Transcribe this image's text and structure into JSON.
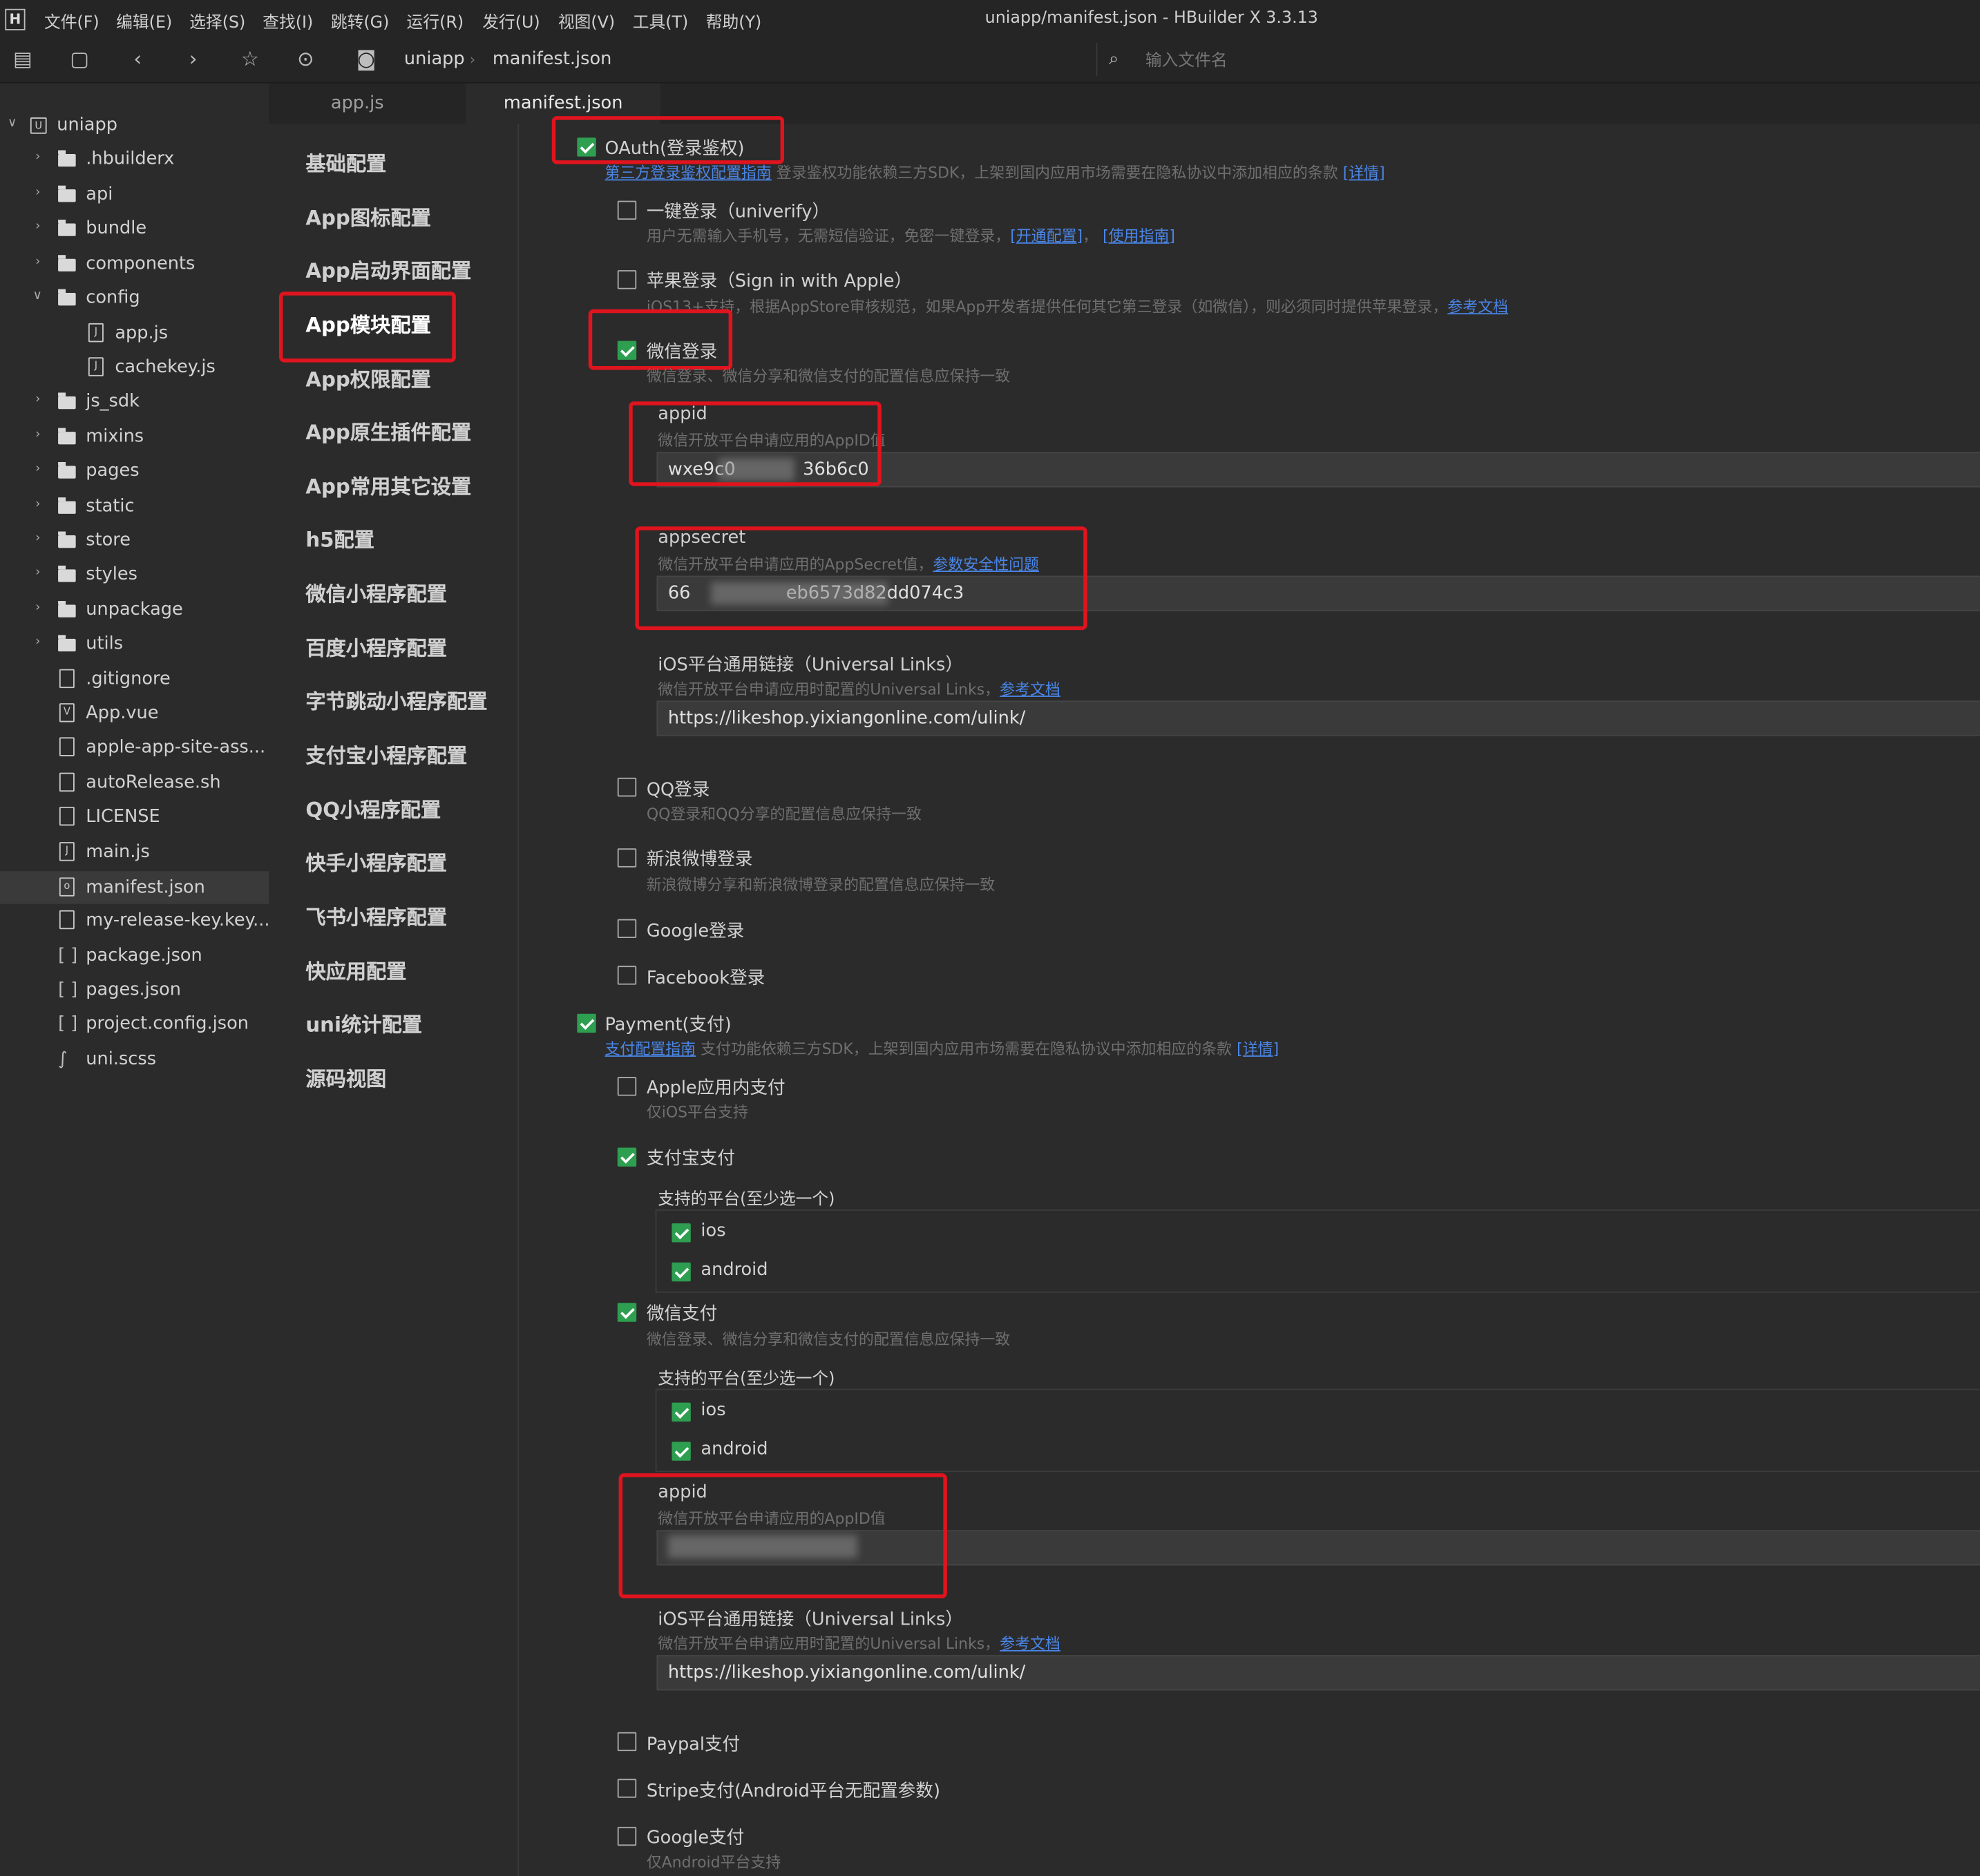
{
  "menubar": {
    "logo": "H",
    "items": [
      "文件(F)",
      "编辑(E)",
      "选择(S)",
      "查找(I)",
      "跳转(G)",
      "运行(R)",
      "发行(U)",
      "视图(V)",
      "工具(T)",
      "帮助(Y)"
    ],
    "title": "uniapp/manifest.json - HBuilder X 3.3.13"
  },
  "toolbar": {
    "crumbs": [
      "uniapp",
      "manifest.json"
    ],
    "search_placeholder": "输入文件名"
  },
  "sidebar": {
    "root": "uniapp",
    "items": [
      ".hbuilderx",
      "api",
      "bundle",
      "components",
      "config",
      "app.js",
      "cachekey.js",
      "js_sdk",
      "mixins",
      "pages",
      "static",
      "store",
      "styles",
      "unpackage",
      "utils",
      ".gitignore",
      "App.vue",
      "apple-app-site-ass...",
      "autoRelease.sh",
      "LICENSE",
      "main.js",
      "manifest.json",
      "my-release-key.key...",
      "package.json",
      "pages.json",
      "project.config.json",
      "uni.scss"
    ]
  },
  "tabs": [
    "app.js",
    "manifest.json"
  ],
  "nav": [
    "基础配置",
    "App图标配置",
    "App启动界面配置",
    "App模块配置",
    "App权限配置",
    "App原生插件配置",
    "App常用其它设置",
    "h5配置",
    "微信小程序配置",
    "百度小程序配置",
    "字节跳动小程序配置",
    "支付宝小程序配置",
    "QQ小程序配置",
    "快手小程序配置",
    "飞书小程序配置",
    "快应用配置",
    "uni统计配置",
    "源码视图"
  ],
  "oauth": {
    "label": "OAuth(登录鉴权)",
    "guide_link": "第三方登录鉴权配置指南",
    "guide_text": "登录鉴权功能依赖三方SDK，上架到国内应用市场需要在隐私协议中添加相应的条款",
    "detail_link": "[详情]",
    "univerify_label": "一键登录（univerify）",
    "univerify_desc": "用户无需输入手机号，无需短信验证，免密一键登录，",
    "univerify_link1": "[开通配置]",
    "univerify_sep": "，",
    "univerify_link2": "[使用指南]",
    "apple_label": "苹果登录（Sign in with Apple）",
    "apple_desc": "iOS13+支持，根据AppStore审核规范，如果App开发者提供任何其它第三登录（如微信），则必须同时提供苹果登录，",
    "apple_link": "参考文档",
    "wechat_label": "微信登录",
    "wechat_desc": "微信登录、微信分享和微信支付的配置信息应保持一致",
    "appid_label": "appid",
    "appid_desc": "微信开放平台申请应用的AppID值",
    "appid_value": "wxe9c0            36b6c0",
    "appsecret_label": "appsecret",
    "appsecret_desc": "微信开放平台申请应用的AppSecret值，",
    "appsecret_link": "参数安全性问题",
    "appsecret_value": "66                 eb6573d82dd074c3",
    "ulink_label": "iOS平台通用链接（Universal Links）",
    "ulink_desc": "微信开放平台申请应用时配置的Universal Links，",
    "ulink_link": "参考文档",
    "ulink_value": "https://likeshop.yixiangonline.com/ulink/",
    "qq_label": "QQ登录",
    "qq_desc": "QQ登录和QQ分享的配置信息应保持一致",
    "weibo_label": "新浪微博登录",
    "weibo_desc": "新浪微博分享和新浪微博登录的配置信息应保持一致",
    "google_label": "Google登录",
    "facebook_label": "Facebook登录"
  },
  "payment": {
    "label": "Payment(支付)",
    "guide_link": "支付配置指南",
    "guide_text": "支付功能依赖三方SDK，上架到国内应用市场需要在隐私协议中添加相应的条款",
    "detail_link": "[详情]",
    "apple_label": "Apple应用内支付",
    "apple_desc": "仅iOS平台支持",
    "alipay_label": "支付宝支付",
    "platform_label": "支持的平台(至少选一个)",
    "ios": "ios",
    "android": "android",
    "wxpay_label": "微信支付",
    "wxpay_desc": "微信登录、微信分享和微信支付的配置信息应保持一致",
    "appid_label": "appid",
    "appid_desc": "微信开放平台申请应用的AppID值",
    "appid_value": "",
    "ulink_label": "iOS平台通用链接（Universal Links）",
    "ulink_desc": "微信开放平台申请应用时配置的Universal Links，",
    "ulink_link": "参考文档",
    "ulink_value": "https://likeshop.yixiangonline.com/ulink/",
    "paypal_label": "Paypal支付",
    "stripe_label": "Stripe支付(Android平台无配置参数)",
    "gpay_label": "Google支付",
    "gpay_desc": "仅Android平台支持"
  },
  "colors": {
    "check": "#2e9e50",
    "highlight": "#e0141e",
    "link": "#4a86e8"
  }
}
